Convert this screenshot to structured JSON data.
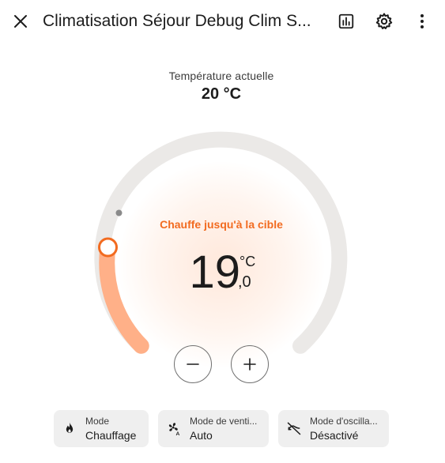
{
  "header": {
    "title": "Climatisation Séjour Debug Clim S...",
    "icons": [
      "close-icon",
      "history-chart-icon",
      "settings-gear-icon",
      "more-vertical-icon"
    ]
  },
  "current": {
    "label": "Température actuelle",
    "value": "20 °C"
  },
  "dial": {
    "action": "Chauffe jusqu'à la cible",
    "target_integer": "19",
    "target_decimal": ",0",
    "unit": "°C",
    "accent_color": "#f26b20",
    "fill_color": "#ffb088",
    "track_color": "#ebe9e7"
  },
  "controls": {
    "minus_icon": "minus-icon",
    "plus_icon": "plus-icon"
  },
  "chips": [
    {
      "label": "Mode",
      "value": "Chauffage",
      "icon": "fire-icon"
    },
    {
      "label": "Mode de venti...",
      "value": "Auto",
      "icon": "fan-auto-icon"
    },
    {
      "label": "Mode d'oscilla...",
      "value": "Désactivé",
      "icon": "swing-off-icon"
    }
  ]
}
